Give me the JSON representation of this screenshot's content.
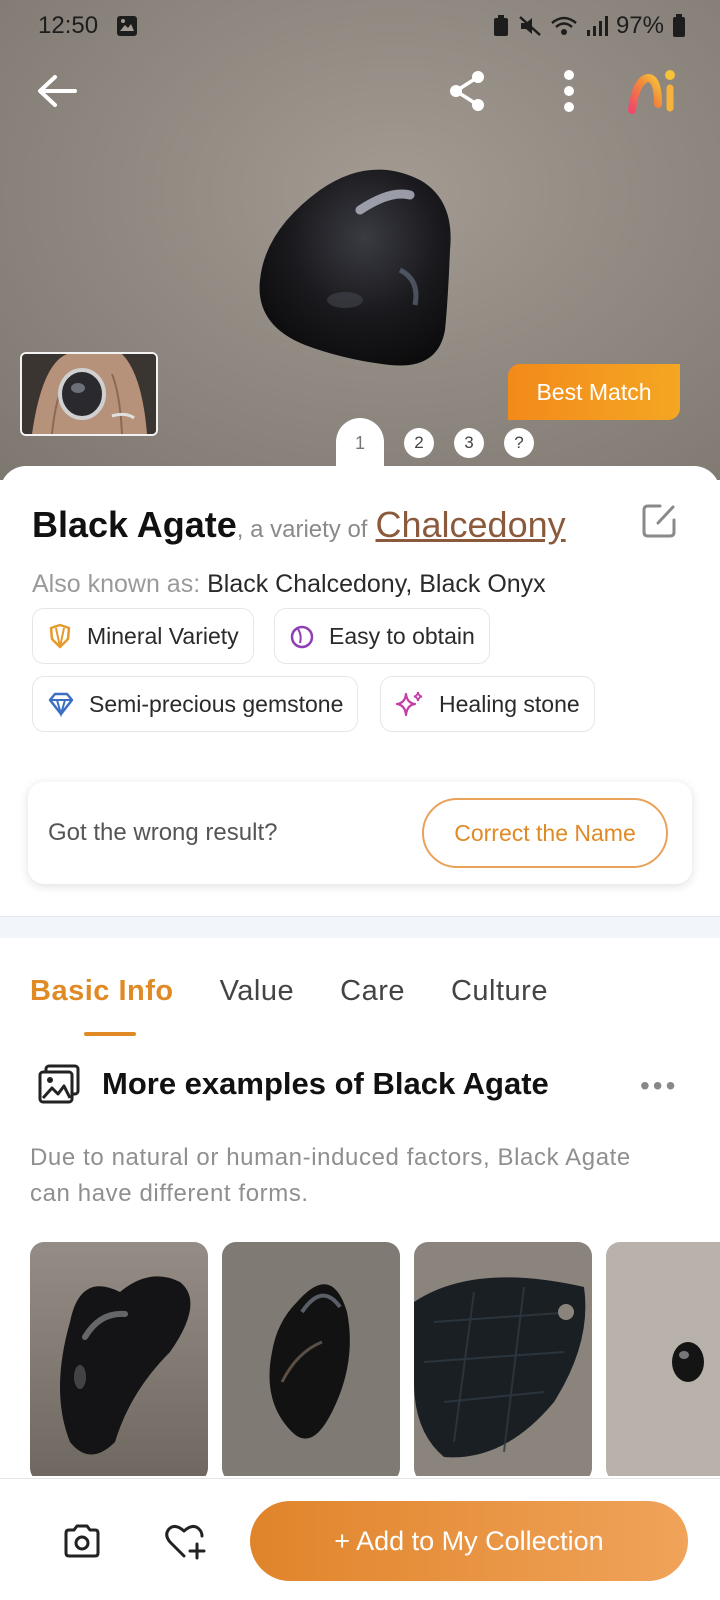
{
  "status_bar": {
    "time": "12:50",
    "battery": "97%"
  },
  "hero": {
    "badge": "Best Match",
    "pager": [
      "1",
      "2",
      "3",
      "?"
    ]
  },
  "identification": {
    "name": "Black Agate",
    "variety_text": ", a variety of",
    "parent": "Chalcedony",
    "aka_label": "Also known as:",
    "aka_value": "Black Chalcedony, Black Onyx",
    "tags": [
      {
        "label": "Mineral Variety",
        "icon": "gem-shield-icon",
        "color": "#e59a2c"
      },
      {
        "label": "Easy to obtain",
        "icon": "ring-icon",
        "color": "#8e3fb6"
      },
      {
        "label": "Semi-precious gemstone",
        "icon": "diamond-icon",
        "color": "#3b6fc4"
      },
      {
        "label": "Healing stone",
        "icon": "sparkle-icon",
        "color": "#c23fa5"
      }
    ],
    "wrong_result_question": "Got the wrong result?",
    "correct_name_button": "Correct the Name"
  },
  "tabs": [
    "Basic Info",
    "Value",
    "Care",
    "Culture"
  ],
  "examples_section": {
    "title": "More examples of Black Agate",
    "description": "Due to natural or human-induced factors, Black Agate can have different forms."
  },
  "bottom_bar": {
    "add_button": "+ Add to My Collection"
  },
  "colors": {
    "accent": "#e08a26",
    "parent_link": "#8b5a3c"
  }
}
